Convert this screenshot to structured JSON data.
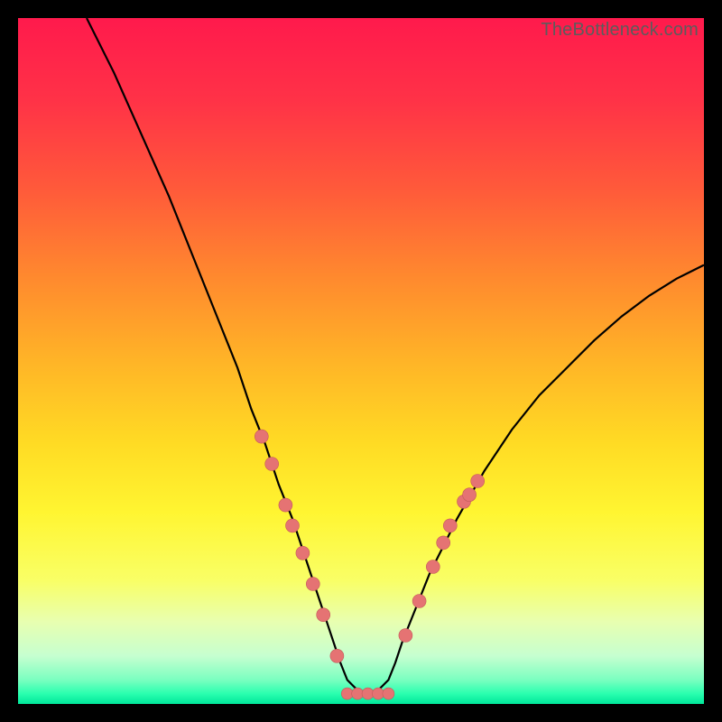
{
  "watermark": "TheBottleneck.com",
  "colors": {
    "bg": "#000000",
    "curve": "#000000",
    "marker_fill": "#e57373",
    "marker_stroke": "#c35a5a",
    "gradient_stops": [
      {
        "offset": 0.0,
        "color": "#ff1a4c"
      },
      {
        "offset": 0.12,
        "color": "#ff3247"
      },
      {
        "offset": 0.25,
        "color": "#ff5a3a"
      },
      {
        "offset": 0.38,
        "color": "#ff8a2e"
      },
      {
        "offset": 0.5,
        "color": "#ffb427"
      },
      {
        "offset": 0.62,
        "color": "#ffdb24"
      },
      {
        "offset": 0.72,
        "color": "#fff531"
      },
      {
        "offset": 0.82,
        "color": "#f9ff66"
      },
      {
        "offset": 0.88,
        "color": "#e8ffb0"
      },
      {
        "offset": 0.93,
        "color": "#c6ffd0"
      },
      {
        "offset": 0.965,
        "color": "#7affc0"
      },
      {
        "offset": 0.985,
        "color": "#2affaf"
      },
      {
        "offset": 1.0,
        "color": "#00e79a"
      }
    ]
  },
  "chart_data": {
    "type": "line",
    "title": "",
    "xlabel": "",
    "ylabel": "",
    "xlim": [
      0,
      100
    ],
    "ylim": [
      0,
      100
    ],
    "grid": false,
    "legend": false,
    "series": [
      {
        "name": "curve",
        "x": [
          10,
          14,
          18,
          22,
          26,
          30,
          32,
          34,
          36,
          38,
          40,
          42,
          44,
          45,
          46,
          47,
          48,
          50,
          52,
          54,
          55,
          56,
          58,
          60,
          62,
          64,
          68,
          72,
          76,
          80,
          84,
          88,
          92,
          96,
          100
        ],
        "y": [
          100,
          92,
          83,
          74,
          64,
          54,
          49,
          43,
          38,
          32,
          27,
          21,
          15,
          12,
          9,
          6,
          3.5,
          1.5,
          1.5,
          3.5,
          6,
          9,
          14,
          19,
          23,
          27,
          34,
          40,
          45,
          49,
          53,
          56.5,
          59.5,
          62,
          64
        ]
      }
    ],
    "flat_bottom": {
      "x_start": 48,
      "x_end": 54,
      "y": 1.5
    },
    "markers_left_branch": [
      {
        "x": 35.5,
        "y": 39
      },
      {
        "x": 37.0,
        "y": 35
      },
      {
        "x": 39.0,
        "y": 29
      },
      {
        "x": 40.0,
        "y": 26
      },
      {
        "x": 41.5,
        "y": 22
      },
      {
        "x": 43.0,
        "y": 17.5
      },
      {
        "x": 44.5,
        "y": 13
      },
      {
        "x": 46.5,
        "y": 7
      }
    ],
    "markers_right_branch": [
      {
        "x": 56.5,
        "y": 10
      },
      {
        "x": 58.5,
        "y": 15
      },
      {
        "x": 60.5,
        "y": 20
      },
      {
        "x": 62.0,
        "y": 23.5
      },
      {
        "x": 63.0,
        "y": 26
      },
      {
        "x": 65.0,
        "y": 29.5
      },
      {
        "x": 65.8,
        "y": 30.5
      },
      {
        "x": 67.0,
        "y": 32.5
      }
    ],
    "markers_bottom": [
      {
        "x": 48.0,
        "y": 1.5
      },
      {
        "x": 49.5,
        "y": 1.5
      },
      {
        "x": 51.0,
        "y": 1.5
      },
      {
        "x": 52.5,
        "y": 1.5
      },
      {
        "x": 54.0,
        "y": 1.5
      }
    ]
  }
}
